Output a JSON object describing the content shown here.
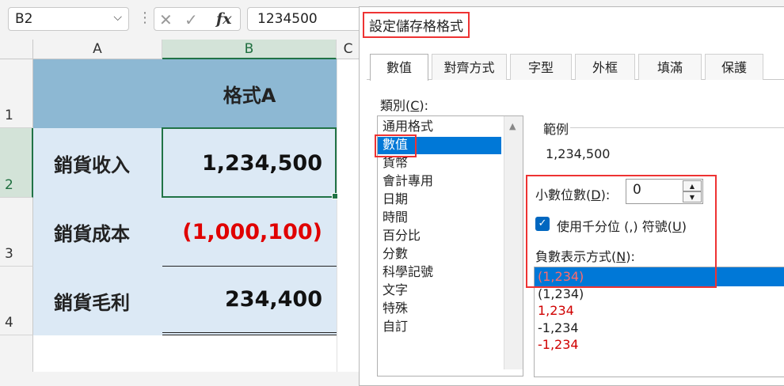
{
  "formula_bar": {
    "name_box": "B2",
    "cancel_glyph": "✕",
    "enter_glyph": "✓",
    "fx_label": "fx",
    "formula_value": "1234500"
  },
  "sheet": {
    "columns": [
      "A",
      "B",
      "C"
    ],
    "rows": [
      "1",
      "2",
      "3",
      "4"
    ],
    "header_b1": "格式A",
    "labels": [
      "銷貨收入",
      "銷貨成本",
      "銷貨毛利"
    ],
    "values": [
      "1,234,500",
      "(1,000,100)",
      "234,400"
    ]
  },
  "dialog": {
    "title": "設定儲存格格式",
    "tabs": [
      "數值",
      "對齊方式",
      "字型",
      "外框",
      "填滿",
      "保護"
    ],
    "category_label": "類別(",
    "category_label_key": "C",
    "category_label_end": "):",
    "categories": [
      "通用格式",
      "數值",
      "貨幣",
      "會計專用",
      "日期",
      "時間",
      "百分比",
      "分數",
      "科學記號",
      "文字",
      "特殊",
      "自訂"
    ],
    "sample_label": "範例",
    "sample_value": "1,234,500",
    "decimal_label": "小數位數(",
    "decimal_key": "D",
    "decimal_end": "):",
    "decimal_value": "0",
    "thousands_label": "使用千分位 (,) 符號(",
    "thousands_key": "U",
    "thousands_end": ")",
    "thousands_checked": true,
    "negative_label": "負數表示方式(",
    "negative_key": "N",
    "negative_end": "):",
    "negative_formats": [
      "(1,234)",
      "(1,234)",
      "1,234",
      "-1,234",
      "-1,234"
    ],
    "negative_red": [
      true,
      false,
      true,
      false,
      true
    ]
  },
  "colors": {
    "accent_green": "#217346",
    "highlight_red": "#e33333",
    "select_blue": "#0078d7",
    "header_blue": "#8db8d3",
    "cell_blue": "#dce9f5"
  }
}
